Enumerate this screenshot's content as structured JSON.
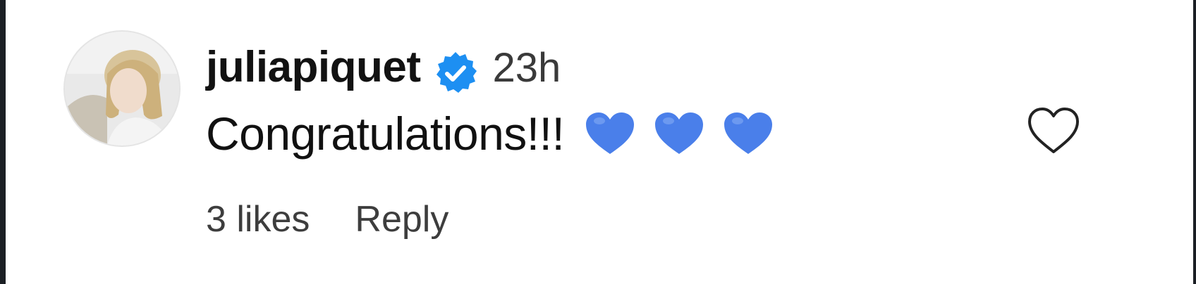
{
  "comment": {
    "username": "juliapiquet",
    "verified": true,
    "timestamp": "23h",
    "text": "Congratulations!!!",
    "emojis": [
      "blue-heart",
      "blue-heart",
      "blue-heart"
    ],
    "likes_label": "3 likes",
    "reply_label": "Reply"
  },
  "icons": {
    "verified": "verified-badge-icon",
    "like": "heart-outline-icon",
    "emoji": "blue-heart-emoji"
  },
  "colors": {
    "verified_badge": "#1d8ff2",
    "emoji_heart": "#4a7fea",
    "text": "#111111",
    "secondary_text": "#3d3d3d",
    "background": "#ffffff"
  }
}
